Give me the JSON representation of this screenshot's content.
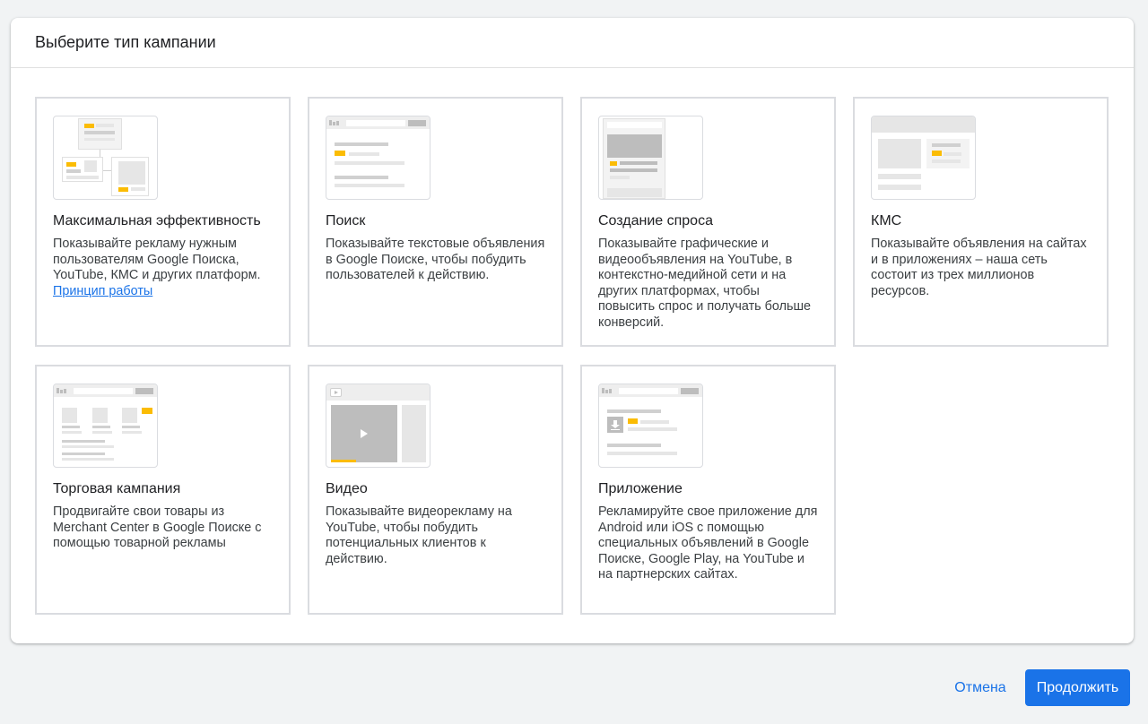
{
  "dialog": {
    "title": "Выберите тип кампании"
  },
  "cards": [
    {
      "title": "Максимальная эффективность",
      "description": "Показывайте рекламу нужным пользователям Google Поиска, YouTube, КМС и других платформ.",
      "link": "Принцип работы",
      "icon": "performance-max-illustration"
    },
    {
      "title": "Поиск",
      "description": "Показывайте текстовые объявления в Google Поиске, чтобы побудить пользователей к действию.",
      "icon": "search-illustration"
    },
    {
      "title": "Создание спроса",
      "description": "Показывайте графические и видеообъявления на YouTube, в контекстно-медийной сети и на других платформах, чтобы повысить спрос и получать больше конверсий.",
      "icon": "demand-gen-illustration"
    },
    {
      "title": "КМС",
      "description": "Показывайте объявления на сайтах и в приложениях – наша сеть состоит из трех миллионов ресурсов.",
      "icon": "display-illustration"
    },
    {
      "title": "Торговая кампания",
      "description": "Продвигайте свои товары из Merchant Center в Google Поиске с помощью товарной рекламы",
      "icon": "shopping-illustration"
    },
    {
      "title": "Видео",
      "description": "Показывайте видеорекламу на YouTube, чтобы побудить потенциальных клиентов к действию.",
      "icon": "video-illustration"
    },
    {
      "title": "Приложение",
      "description": "Рекламируйте свое приложение для Android или iOS с помощью специальных объявлений в Google Поиске, Google Play, на YouTube и на партнерских сайтах.",
      "icon": "app-illustration"
    }
  ],
  "footer": {
    "cancel_label": "Отмена",
    "continue_label": "Продолжить"
  },
  "colors": {
    "accent": "#1a73e8",
    "highlight": "#fbbc04",
    "border": "#dadce0"
  }
}
